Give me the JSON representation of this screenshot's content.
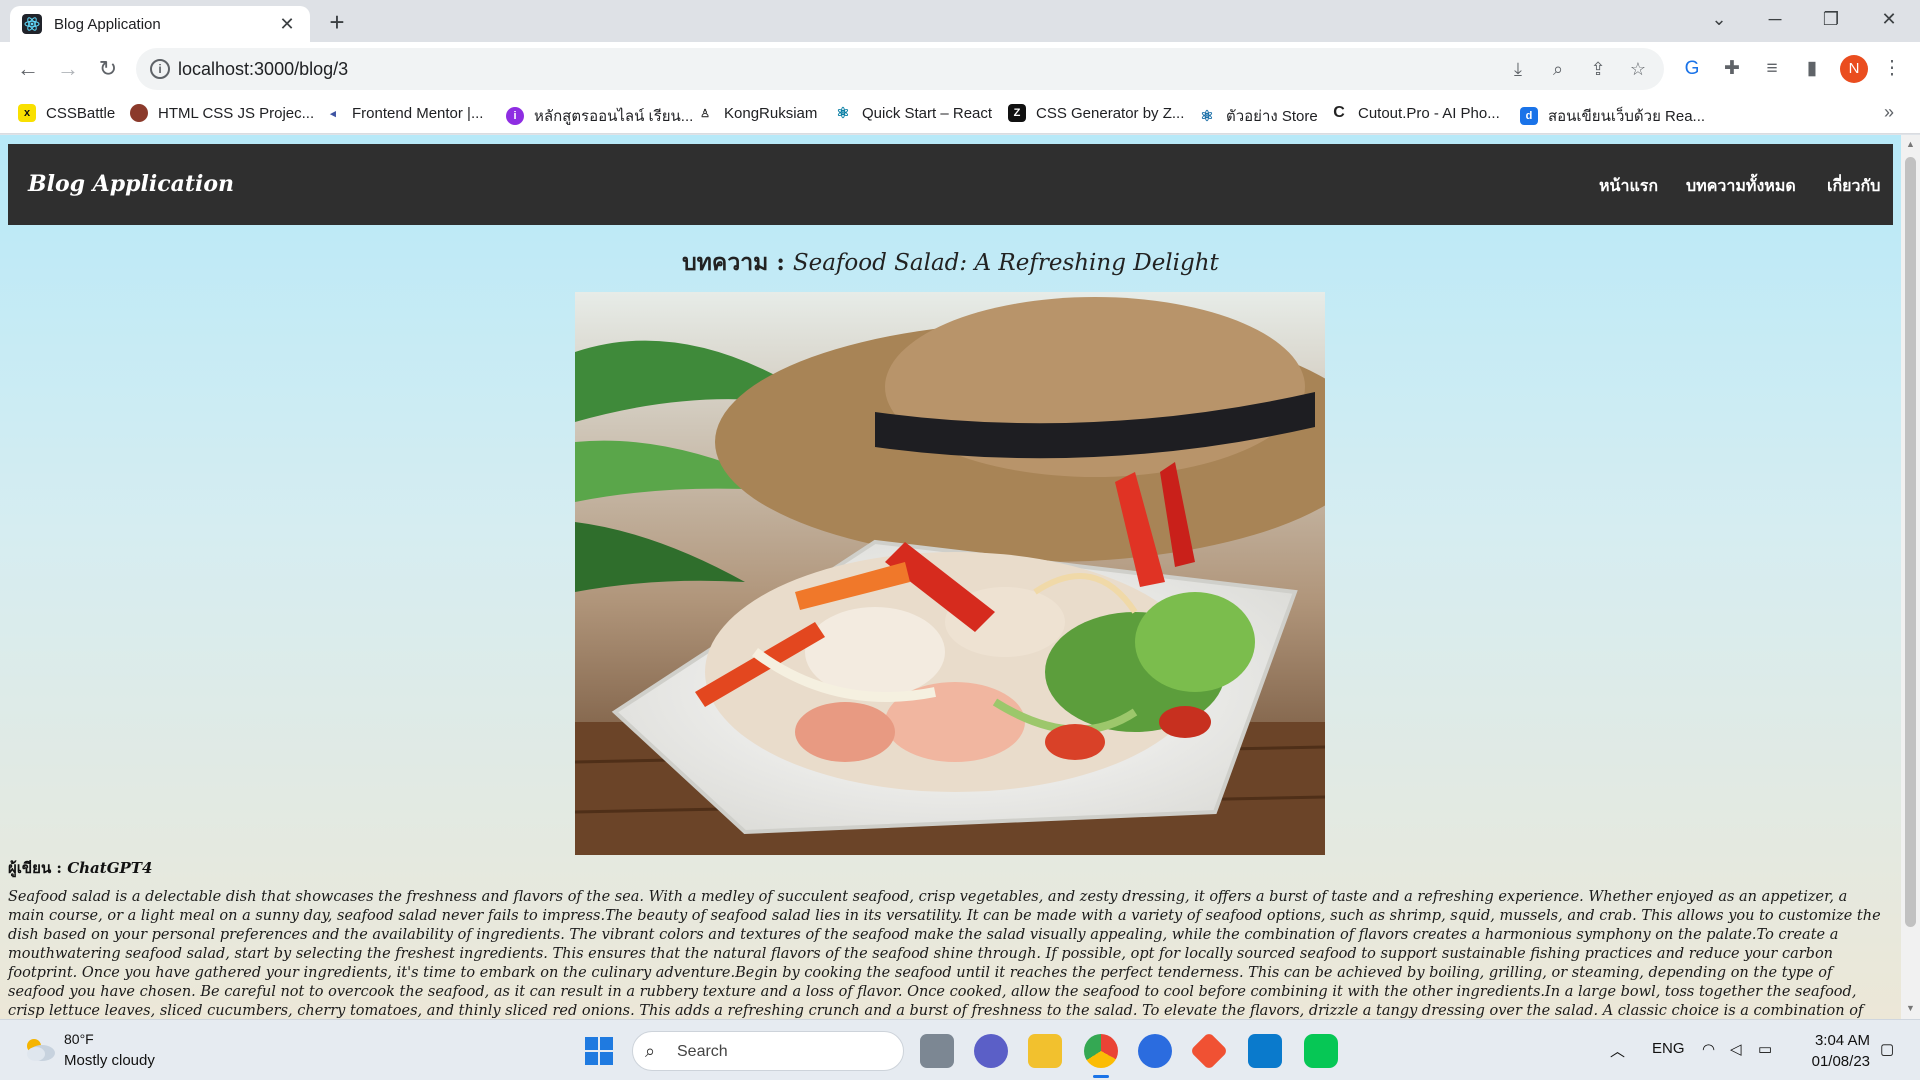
{
  "browser": {
    "tab_title": "Blog Application",
    "url": "localhost:3000/blog/3",
    "profile_initial": "N",
    "bookmarks": [
      {
        "label": "CSSBattle",
        "icon": "cssbattle-icon",
        "color": "#f9e000"
      },
      {
        "label": "HTML CSS JS Projec...",
        "icon": "html-projects-icon",
        "color": "#8b3a2b"
      },
      {
        "label": "Frontend Mentor |...",
        "icon": "frontend-mentor-icon",
        "color": "#3e54a3"
      },
      {
        "label": "หลักสูตรออนไลน์ เรียน...",
        "icon": "online-course-icon",
        "color": "#8e2de2"
      },
      {
        "label": "KongRuksiam",
        "icon": "kongruksiam-icon",
        "color": "#333333"
      },
      {
        "label": "Quick Start – React",
        "icon": "react-icon",
        "color": "#087ea4"
      },
      {
        "label": "CSS Generator by Z...",
        "icon": "css-generator-icon",
        "color": "#111111"
      },
      {
        "label": "ตัวอย่าง Store",
        "icon": "store-icon",
        "color": "#1b6fa8"
      },
      {
        "label": "Cutout.Pro - AI Pho...",
        "icon": "cutout-icon",
        "color": "#222222"
      },
      {
        "label": "สอนเขียนเว็บด้วย Rea...",
        "icon": "learn-react-icon",
        "color": "#1a73e8"
      }
    ]
  },
  "site": {
    "brand": "Blog Application",
    "nav": [
      "หน้าแรก",
      "บทความทั้งหมด",
      "เกี่ยวกับ"
    ]
  },
  "post": {
    "title_prefix": "บทความ : ",
    "title": "Seafood Salad: A Refreshing Delight",
    "author_label": "ผู้เขียน : ",
    "author": "ChatGPT4",
    "content": "Seafood salad is a delectable dish that showcases the freshness and flavors of the sea. With a medley of succulent seafood, crisp vegetables, and zesty dressing, it offers a burst of taste and a refreshing experience. Whether enjoyed as an appetizer, a main course, or a light meal on a sunny day, seafood salad never fails to impress.The beauty of seafood salad lies in its versatility. It can be made with a variety of seafood options, such as shrimp, squid, mussels, and crab. This allows you to customize the dish based on your personal preferences and the availability of ingredients. The vibrant colors and textures of the seafood make the salad visually appealing, while the combination of flavors creates a harmonious symphony on the palate.To create a mouthwatering seafood salad, start by selecting the freshest ingredients. This ensures that the natural flavors of the seafood shine through. If possible, opt for locally sourced seafood to support sustainable fishing practices and reduce your carbon footprint. Once you have gathered your ingredients, it's time to embark on the culinary adventure.Begin by cooking the seafood until it reaches the perfect tenderness. This can be achieved by boiling, grilling, or steaming, depending on the type of seafood you have chosen. Be careful not to overcook the seafood, as it can result in a rubbery texture and a loss of flavor. Once cooked, allow the seafood to cool before combining it with the other ingredients.In a large bowl, toss together the seafood, crisp lettuce leaves, sliced cucumbers, cherry tomatoes, and thinly sliced red onions. This adds a refreshing crunch and a burst of freshness to the salad. To elevate the flavors, drizzle a tangy dressing over the salad. A classic choice is a combination of lemon juice, olive oil, minced garlic, and a pinch of salt and pepper. However, feel free to experiment with other dressings that complement the"
  },
  "taskbar": {
    "temperature": "80°F",
    "weather": "Mostly cloudy",
    "search_placeholder": "Search",
    "language": "ENG",
    "time": "3:04 AM",
    "date": "01/08/23"
  }
}
